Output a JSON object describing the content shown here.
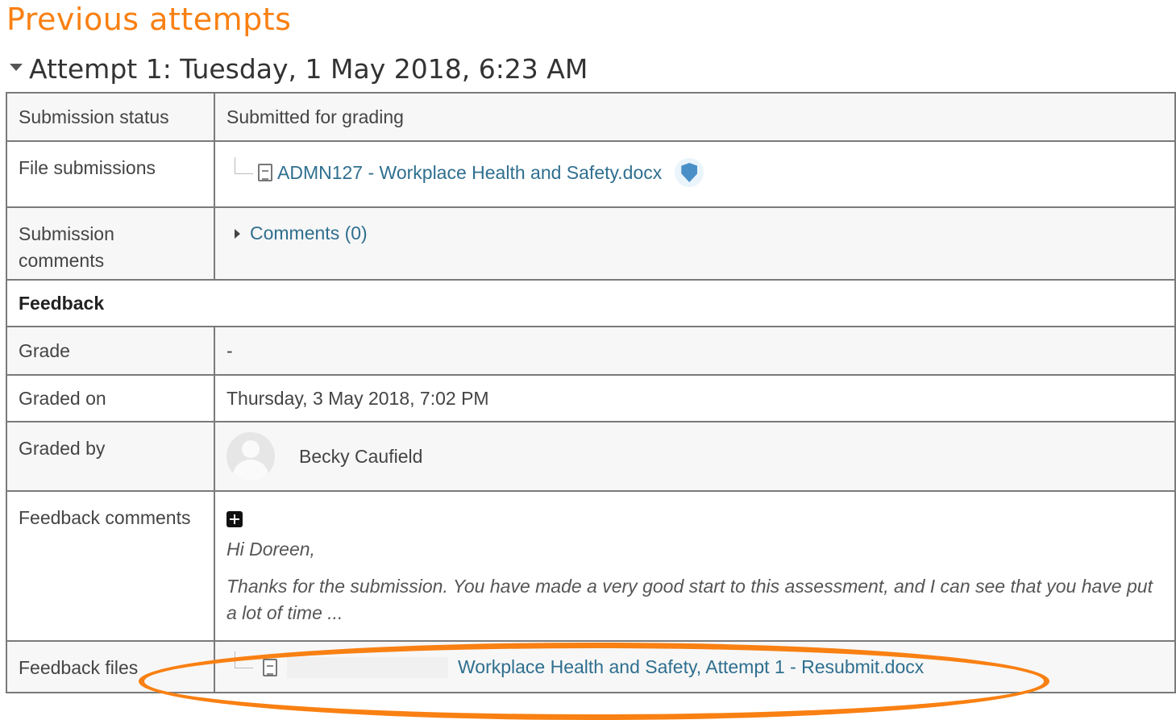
{
  "heading": "Previous attempts",
  "attempt": {
    "title": "Attempt 1: Tuesday, 1 May 2018, 6:23 AM"
  },
  "rows": {
    "submission_status": {
      "label": "Submission status",
      "value": "Submitted for grading"
    },
    "file_submissions": {
      "label": "File submissions",
      "file_name": "ADMN127 - Workplace Health and Safety.docx",
      "icon": "shield-icon"
    },
    "submission_comments": {
      "label": "Submission comments",
      "comments_link": "Comments (0)"
    },
    "feedback": {
      "label": "Feedback"
    },
    "grade": {
      "label": "Grade",
      "value": "-"
    },
    "graded_on": {
      "label": "Graded on",
      "value": "Thursday, 3 May 2018, 7:02 PM"
    },
    "graded_by": {
      "label": "Graded by",
      "name": "Becky Caufield"
    },
    "feedback_comments": {
      "label": "Feedback comments",
      "greeting": "Hi Doreen,",
      "text": "Thanks for the submission. You have made a very good start to this assessment, and I can see that you have put a lot of time ..."
    },
    "feedback_files": {
      "label": "Feedback files",
      "file_name": "Workplace Health and Safety, Attempt 1 - Resubmit.docx"
    }
  },
  "colors": {
    "accent": "#f98012",
    "link": "#2f6f8f",
    "border": "#7a7a7a"
  }
}
